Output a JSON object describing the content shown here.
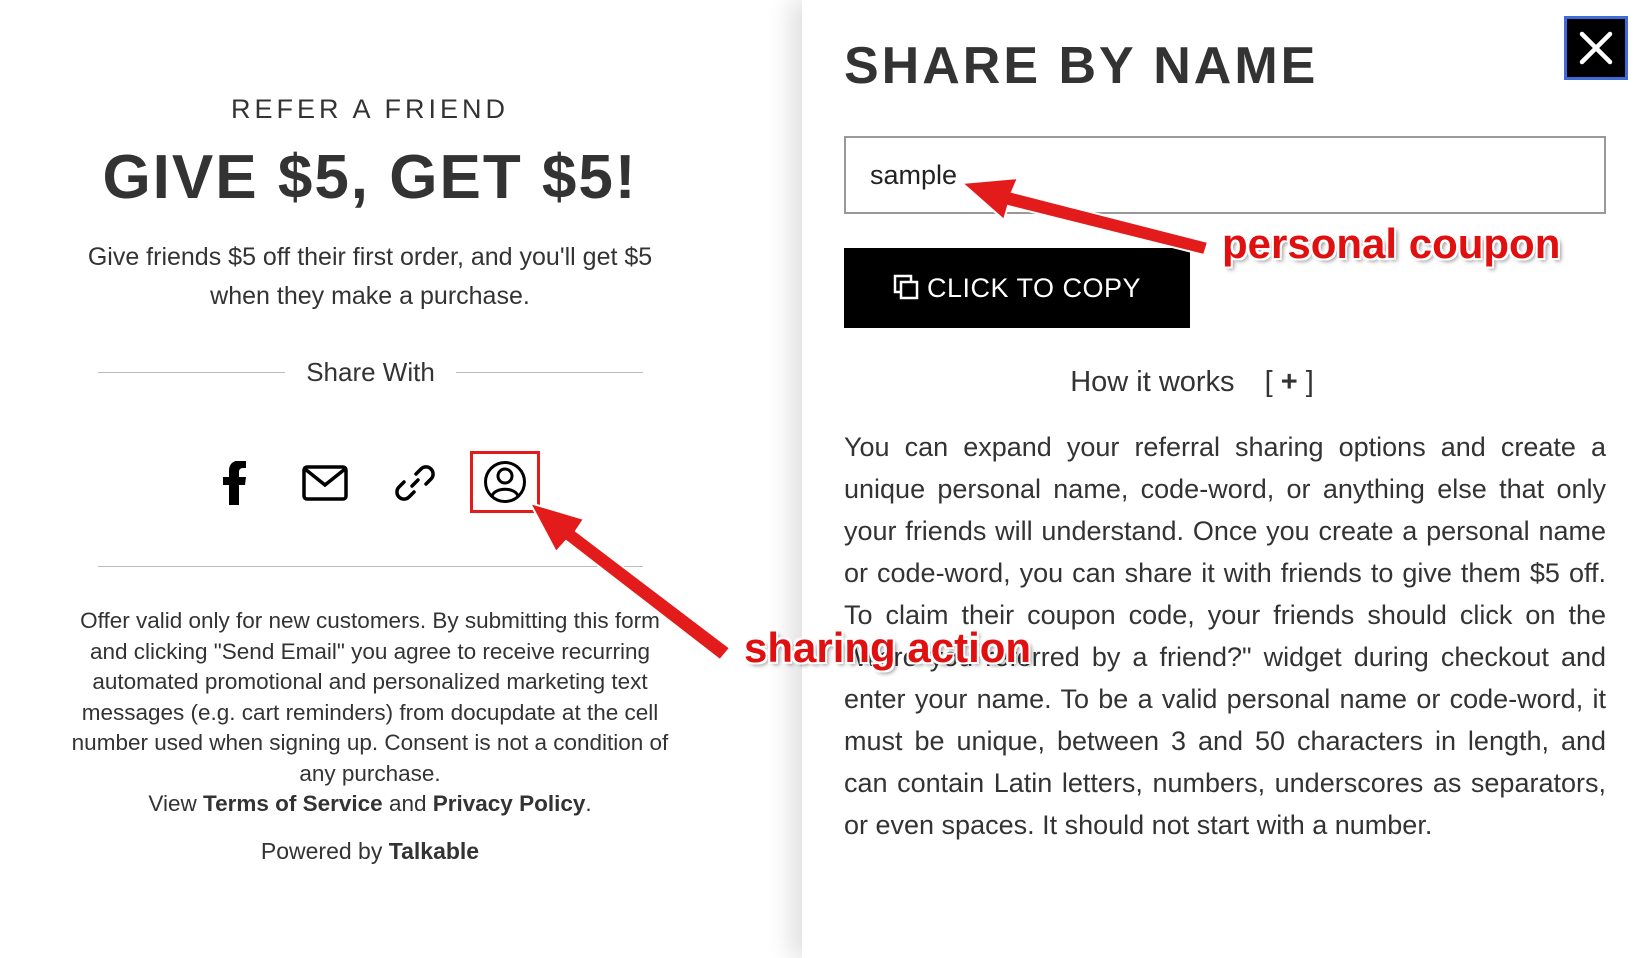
{
  "left": {
    "eyebrow": "REFER A FRIEND",
    "headline": "GIVE $5, GET $5!",
    "subtext": "Give friends $5 off their first order, and you'll get $5 when they make a purchase.",
    "share_with": "Share With",
    "share_icons": [
      "facebook-icon",
      "email-icon",
      "link-icon",
      "user-icon"
    ],
    "legal": {
      "text": "Offer valid only for new customers. By submitting this form and clicking \"Send Email\" you agree to receive recurring automated promotional and personalized marketing text messages (e.g. cart reminders) from docupdate at the cell number used when signing up. Consent is not a condition of any purchase.",
      "view": "View",
      "terms": "Terms of Service",
      "and": "and",
      "privacy": "Privacy Policy",
      "period": "."
    },
    "powered_by": "Powered by",
    "powered_brand": "Talkable"
  },
  "right": {
    "title": "SHARE BY NAME",
    "coupon_value": "sample",
    "copy_label": "CLICK TO COPY",
    "how_label": "How it works",
    "how_toggle_open": "[",
    "how_toggle_plus": "+",
    "how_toggle_close": "]",
    "description": "You can expand your referral sharing options and create a unique personal name, code-word, or anything else that only your friends will understand. Once you create a personal name or code-word, you can share it with friends to give them $5 off. To claim their coupon code, your friends should click on the \"Were you referred by a friend?\" widget during checkout and enter your name. To be a valid personal name or code-word, it must be unique, between 3 and 50 characters in length, and can contain Latin letters, numbers, underscores as separators, or even spaces. It should not start with a number."
  },
  "annotations": {
    "coupon": "personal coupon",
    "sharing": "sharing action",
    "color": "#e41b1b"
  }
}
